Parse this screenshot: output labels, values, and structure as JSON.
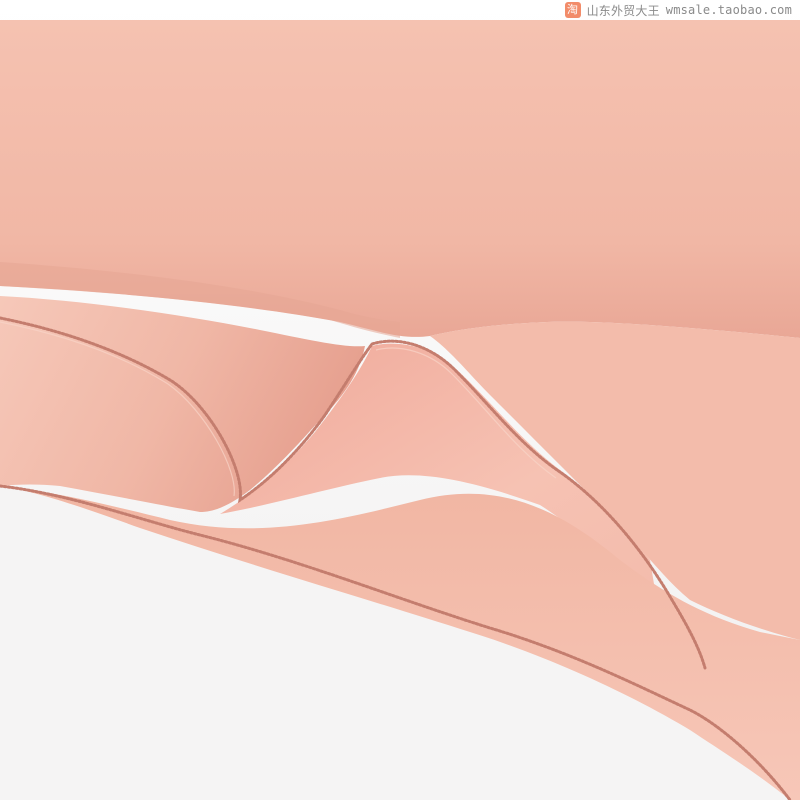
{
  "photo": {
    "subject": "pink fabric fold",
    "colors": {
      "background": "#f6f6f6",
      "fabric_light": "#f7c6b6",
      "fabric_mid": "#efb2a0",
      "fabric_shadow": "#d7907f",
      "stitch": "#c97f70"
    }
  },
  "watermark": {
    "logo_glyph": "淘",
    "shop_name": "山东外贸大王",
    "url": "wmsale.taobao.com"
  }
}
